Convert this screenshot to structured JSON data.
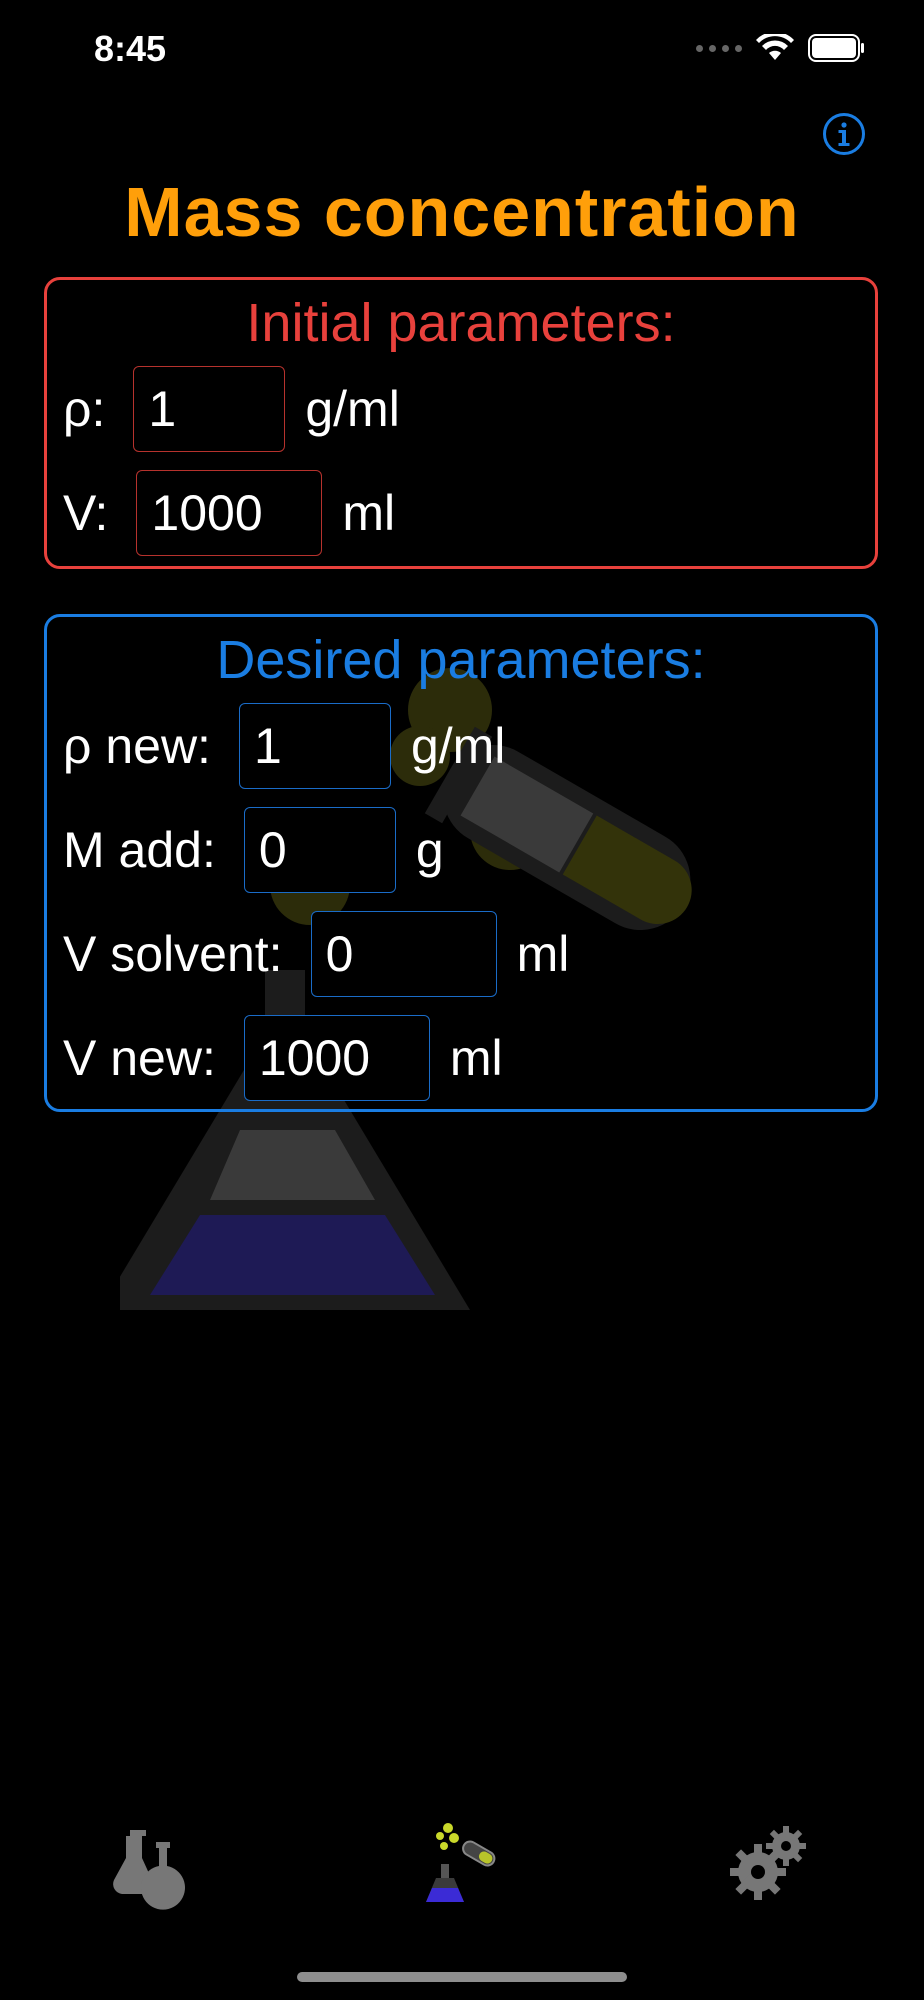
{
  "status_bar": {
    "time": "8:45",
    "icons": [
      "signal-icon",
      "wifi-icon",
      "battery-icon"
    ]
  },
  "header": {
    "info_icon": "info-icon",
    "title": "Mass concentration"
  },
  "initial": {
    "title": "Initial parameters:",
    "density": {
      "label": "ρ:",
      "value": "1",
      "unit": "g/ml"
    },
    "volume": {
      "label": "V:",
      "value": "1000",
      "unit": "ml"
    }
  },
  "desired": {
    "title": "Desired parameters:",
    "density_new": {
      "label": "ρ new:",
      "value": "1",
      "unit": "g/ml"
    },
    "mass_add": {
      "label": "M add:",
      "value": "0",
      "unit": "g"
    },
    "volume_solvent": {
      "label": "V solvent:",
      "value": "0",
      "unit": "ml"
    },
    "volume_new": {
      "label": "V new:",
      "value": "1000",
      "unit": "ml"
    }
  },
  "tab_bar": {
    "tabs": [
      {
        "icon": "flasks-icon",
        "selected": false
      },
      {
        "icon": "chemistry-mix-icon",
        "selected": true
      },
      {
        "icon": "gears-icon",
        "selected": false
      }
    ]
  },
  "colors": {
    "title": "#ff9f0a",
    "initial_accent": "#e8413c",
    "desired_accent": "#1a7de2",
    "background": "#000000"
  }
}
